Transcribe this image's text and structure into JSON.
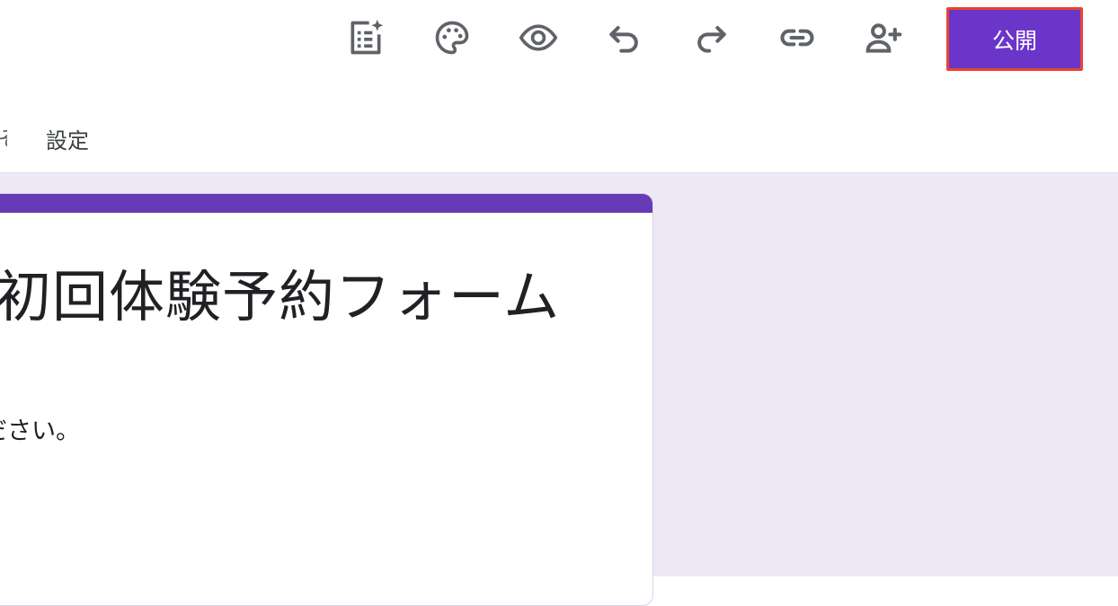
{
  "toolbar": {
    "icons": [
      {
        "name": "form-ai-icon"
      },
      {
        "name": "palette-icon"
      },
      {
        "name": "eye-icon"
      },
      {
        "name": "undo-icon"
      },
      {
        "name": "redo-icon"
      },
      {
        "name": "link-icon"
      },
      {
        "name": "add-person-icon"
      }
    ],
    "publish_label": "公開",
    "icon_color": "#5f6368",
    "publish_color": "#6b35c9"
  },
  "tabs": {
    "partial_label": "ぞ",
    "settings_label": "設定"
  },
  "form": {
    "title": "初回体験予約フォーム",
    "description_line_1": "ださい。",
    "description_line_2": "。",
    "accent_color": "#673ab7",
    "background_color": "#ede9f6"
  }
}
